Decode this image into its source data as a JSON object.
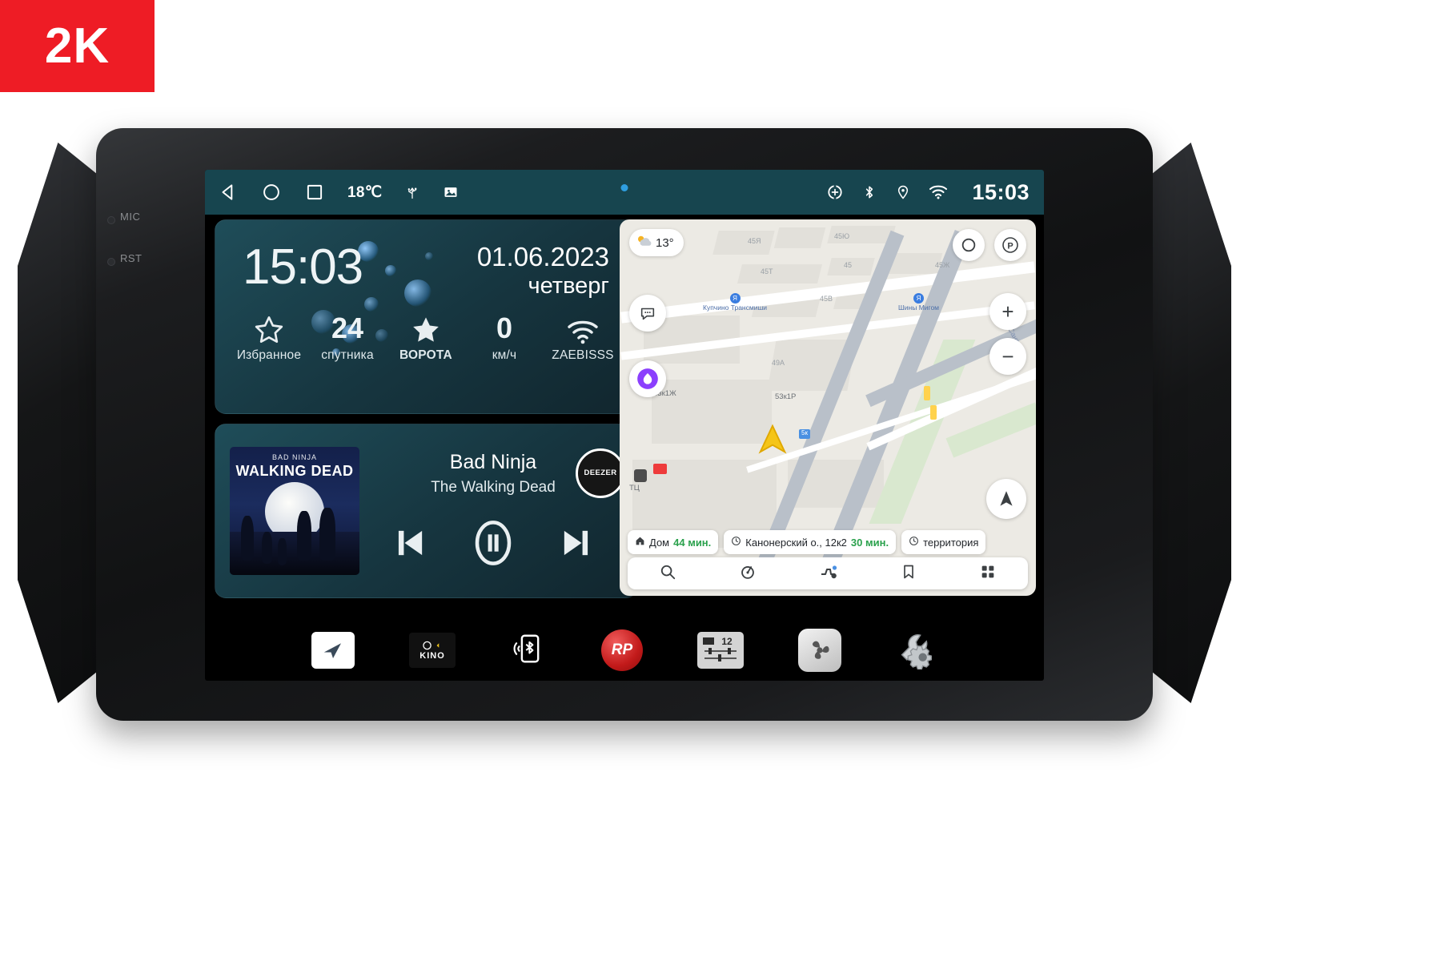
{
  "badge": {
    "label": "2K"
  },
  "device": {
    "left_leds": [
      {
        "name": "MIC",
        "label": "MIC"
      },
      {
        "name": "RST",
        "label": "RST"
      }
    ]
  },
  "statusbar": {
    "nav": [
      {
        "icon": "back-icon",
        "name": "back"
      },
      {
        "icon": "home-circle-icon",
        "name": "home"
      },
      {
        "icon": "recents-square-icon",
        "name": "recents"
      }
    ],
    "temperature": "18℃",
    "icons_left": [
      "usb-icon",
      "screenshot-icon"
    ],
    "icons_right": [
      "gps-target-icon",
      "bluetooth-icon",
      "location-pin-icon",
      "wifi-icon"
    ],
    "clock": "15:03"
  },
  "clock_widget": {
    "time": "15:03",
    "date": "01.06.2023",
    "weekday": "четверг",
    "stats": [
      {
        "icon": "star-outline-icon",
        "value": "",
        "label": "Избранное"
      },
      {
        "icon": "",
        "value": "24",
        "label": "спутника"
      },
      {
        "icon": "star-filled-icon",
        "value": "",
        "label": "ВОРОТА"
      },
      {
        "icon": "",
        "value": "0",
        "label": "км/ч"
      },
      {
        "icon": "wifi-icon",
        "value": "",
        "label": "ZAEBISSS"
      }
    ]
  },
  "media": {
    "album_title_small": "BAD NINJA",
    "album_title_big": "WALKING DEAD",
    "track": "Bad Ninja",
    "artist": "The Walking Dead",
    "source_badge": "DEEZER",
    "controls": [
      {
        "name": "previous-button",
        "icon": "skip-previous-icon"
      },
      {
        "name": "pause-button",
        "icon": "pause-icon"
      },
      {
        "name": "next-button",
        "icon": "skip-next-icon"
      }
    ]
  },
  "map": {
    "weather": {
      "icon": "sun-cloud-icon",
      "temp": "13°"
    },
    "buttons": {
      "chat": "chat-bubble-icon",
      "assistant": "alice-assistant-icon",
      "layers": "layers-icon",
      "parking": "P",
      "zoom_in": "+",
      "zoom_out": "−",
      "compass": "navigation-arrow-icon"
    },
    "labels": [
      "45Я",
      "45Ю",
      "45Т",
      "45",
      "45Ж",
      "45В",
      "49А",
      "53к1Ж",
      "53к1Р",
      "ТЦ",
      "Сано"
    ],
    "pois": [
      {
        "name": "Купчино Трансмиши"
      },
      {
        "name": "Шины Мигом"
      }
    ],
    "route_chips": [
      {
        "icon": "home-icon",
        "label": "Дом",
        "time": "44 мин.",
        "color": "green"
      },
      {
        "icon": "clock-icon",
        "label": "Канонерский о., 12к2",
        "time": "30 мин.",
        "color": "green"
      },
      {
        "icon": "clock-icon",
        "label": "территория",
        "time": "",
        "color": "green"
      }
    ],
    "toolbar": [
      {
        "name": "search-icon"
      },
      {
        "name": "navigator-icon"
      },
      {
        "name": "traffic-icon"
      },
      {
        "name": "bookmark-icon"
      },
      {
        "name": "grid-menu-icon"
      }
    ]
  },
  "dock": [
    {
      "name": "navigation-app",
      "icon": "paper-plane-icon",
      "label": ""
    },
    {
      "name": "kino-app",
      "icon": "kino-icon",
      "label": "KINO"
    },
    {
      "name": "bluetooth-phone-app",
      "icon": "phone-bluetooth-icon",
      "label": ""
    },
    {
      "name": "radio-app",
      "icon": "rp-icon",
      "label": "RP"
    },
    {
      "name": "equalizer-app",
      "icon": "equalizer-icon",
      "label": "12"
    },
    {
      "name": "climate-app",
      "icon": "fan-icon",
      "label": ""
    },
    {
      "name": "settings-app",
      "icon": "wrench-gear-icon",
      "label": ""
    }
  ]
}
